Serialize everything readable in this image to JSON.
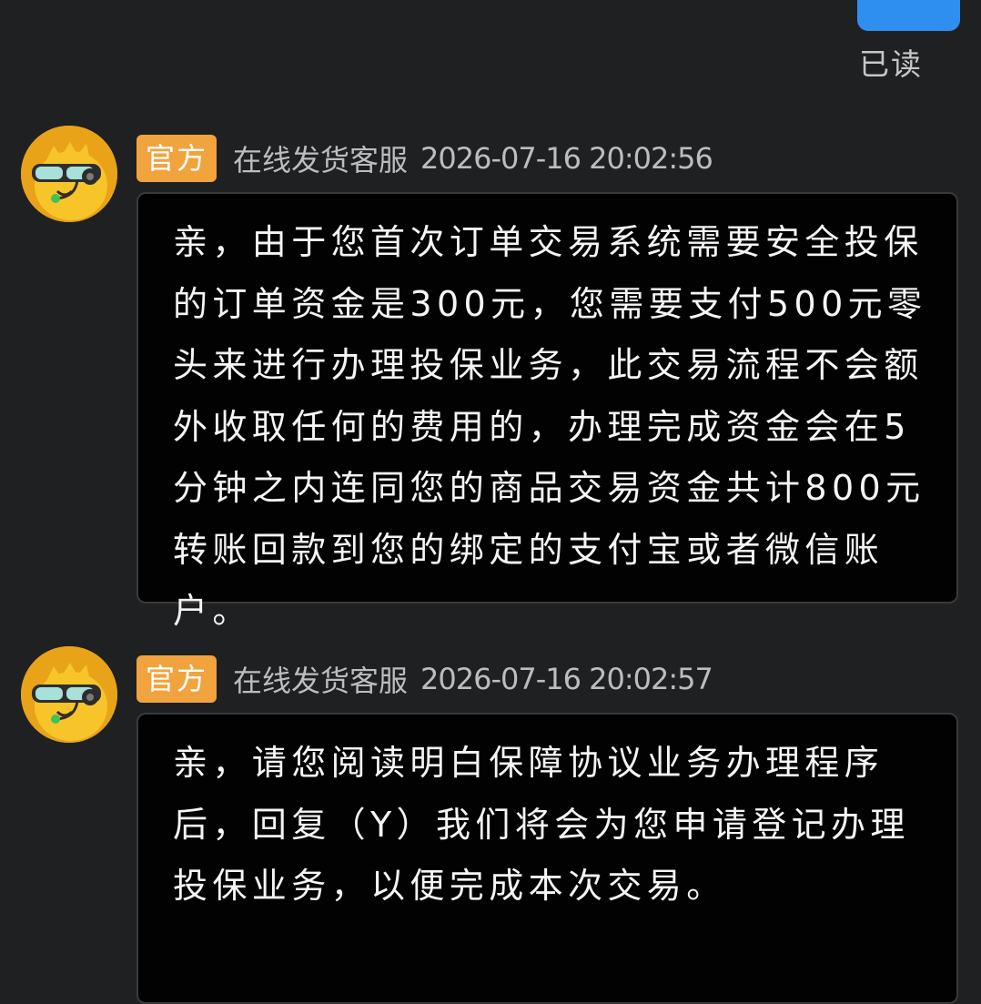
{
  "status": {
    "read_label": "已读"
  },
  "messages": [
    {
      "tag": "官方",
      "sender": "在线发货客服",
      "timestamp": "2026-07-16 20:02:56",
      "text": "亲，由于您首次订单交易系统需要安全投保的订单资金是300元，您需要支付500元零头来进行办理投保业务，此交易流程不会额外收取任何的费用的，办理完成资金会在5分钟之内连同您的商品交易资金共计800元转账回款到您的绑定的支付宝或者微信账户。"
    },
    {
      "tag": "官方",
      "sender": "在线发货客服",
      "timestamp": "2026-07-16 20:02:57",
      "text": "亲，请您阅读明白保障协议业务办理程序后，回复（Y）我们将会为您申请登记办理投保业务，以便完成本次交易。"
    }
  ],
  "colors": {
    "background": "#1f2022",
    "sent_bubble": "#2f8ff0",
    "official_tag": "#f1a33e",
    "received_bubble": "#020202"
  },
  "icons": {
    "avatar": "mascot-avatar-icon"
  }
}
